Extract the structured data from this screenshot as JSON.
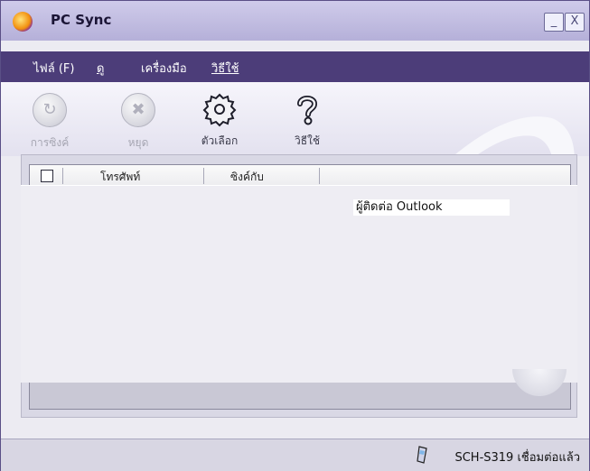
{
  "window": {
    "title": "PC Sync",
    "min_label": "_",
    "close_label": "X"
  },
  "menu": {
    "file": "ไฟล์ (F)",
    "view": "ดู",
    "tools": "เครื่องมือ",
    "help": "วิธีใช้"
  },
  "toolbar": {
    "sync": "การซิงค์",
    "stop": "หยุด",
    "options": "ตัวเลือก",
    "help": "วิธีใช้"
  },
  "list": {
    "headers": [
      "โทรศัพท์",
      "ซิงค์กับ"
    ]
  },
  "popup": {
    "item": "ผู้ติดต่อ Outlook"
  },
  "status": {
    "text": "SCH-S319 เชื่อมต่อแล้ว"
  },
  "colors": {
    "menubar": "#4c3d79",
    "titlebar": "#c3bfe3"
  }
}
